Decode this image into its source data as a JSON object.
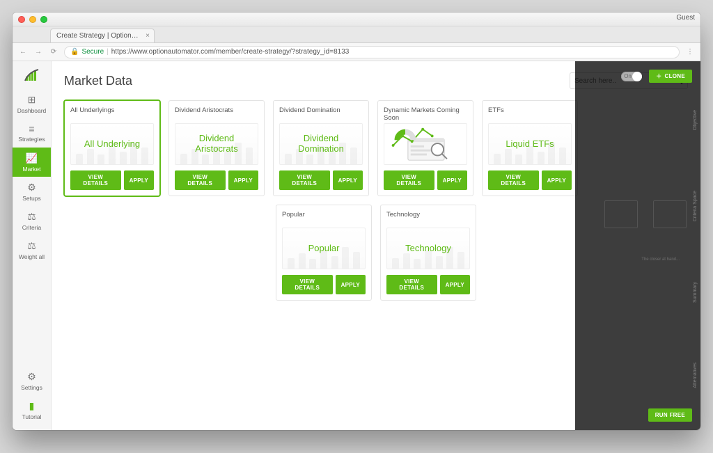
{
  "browser": {
    "tab_title": "Create Strategy | OptionAutom",
    "guest_label": "Guest",
    "secure_label": "Secure",
    "url": "https://www.optionautomator.com/member/create-strategy/?strategy_id=8133"
  },
  "sidebar": {
    "items": [
      {
        "label": "Dashboard"
      },
      {
        "label": "Strategies"
      },
      {
        "label": "Market"
      },
      {
        "label": "Setups"
      },
      {
        "label": "Criteria"
      },
      {
        "label": "Weight all"
      }
    ],
    "bottom": [
      {
        "label": "Settings"
      },
      {
        "label": "Tutorial"
      }
    ]
  },
  "header": {
    "title": "Market Data",
    "search_placeholder": "Search here.."
  },
  "buttons": {
    "view_details": "VIEW DETAILS",
    "apply": "APPLY"
  },
  "cards_row1": [
    {
      "title": "All Underlyings",
      "thumb": "All Underlying",
      "active": true
    },
    {
      "title": "Dividend Aristocrats",
      "thumb": "Dividend Aristocrats"
    },
    {
      "title": "Dividend Domination",
      "thumb": "Dividend Domination"
    },
    {
      "title": "Dynamic Markets Coming Soon",
      "thumb": "",
      "dynamic": true
    },
    {
      "title": "ETFs",
      "thumb": "Liquid ETFs"
    }
  ],
  "cards_row2": [
    {
      "title": "Popular",
      "thumb": "Popular"
    },
    {
      "title": "Technology",
      "thumb": "Technology"
    }
  ],
  "overlay": {
    "toggle_label": "On",
    "clone": "CLONE",
    "run": "RUN FREE",
    "vtabs": [
      "Objective",
      "Criteria Space",
      "Summary",
      "Alternatives"
    ]
  }
}
